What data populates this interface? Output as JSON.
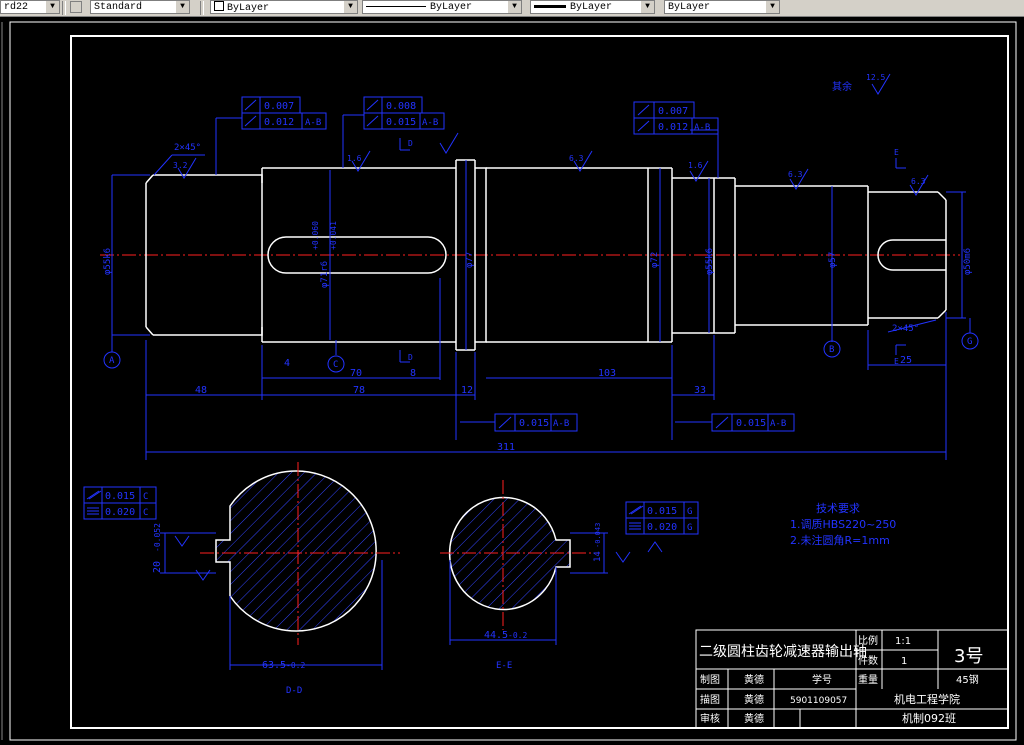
{
  "toolbar": {
    "dimstyle": "rd22",
    "textstyle": "Standard",
    "layer_color": "ByLayer",
    "linetype": "ByLayer",
    "lineweight": "ByLayer",
    "plotstyle": "ByLayer"
  },
  "drawing": {
    "roughness_default_label": "其余",
    "roughness_default_value": "12.5",
    "chamfer_left": "2×45°",
    "chamfer_right": "2×45°",
    "gdt_boxes": [
      {
        "row1": "0.007",
        "row2": "0.012",
        "datum": "A-B"
      },
      {
        "row1": "0.008",
        "row2": "0.015",
        "datum": "A-B"
      },
      {
        "row1": "0.007",
        "row2": "0.012",
        "datum": "A-B"
      }
    ],
    "gdt_bottom_left": {
      "value": "0.015",
      "datum": "A-B"
    },
    "gdt_bottom_right": {
      "value": "0.015",
      "datum": "A-B"
    },
    "roughness_marks": [
      "3.2",
      "1.6",
      "1.6",
      "6.3",
      "1.6",
      "6.3",
      "6.3",
      "3.2"
    ],
    "dims": {
      "d1": "φ55k6",
      "d2": "φ71r6",
      "d3": "φ77",
      "d4": "φ72",
      "d5": "φ55k6",
      "d6": "φ57",
      "d7": "φ50m6",
      "l_48": "48",
      "l_78": "78",
      "l_12": "12",
      "l_103": "103",
      "l_33": "33",
      "l_25": "25",
      "l_311": "311",
      "l_70": "70",
      "l_8": "8",
      "l_4": "4",
      "key_tol_top": "+0.060",
      "key_tol_bot": "+0.041"
    },
    "datums": [
      "A",
      "C",
      "B",
      "G"
    ],
    "section_marks": [
      "D",
      "D",
      "E",
      "E"
    ],
    "section_d": {
      "title": "D-D",
      "dim_width": "63.5",
      "dim_width_tol": "-0.2",
      "dim_key": "20",
      "dim_key_tol": "-0.052",
      "gdt1": {
        "value": "0.015",
        "datum": "C"
      },
      "gdt2": {
        "value": "0.020",
        "datum": "C"
      }
    },
    "section_e": {
      "title": "E-E",
      "dim_width": "44.5",
      "dim_width_tol": "-0.2",
      "dim_key": "14",
      "dim_key_tol": "-0.043",
      "gdt1": {
        "value": "0.015",
        "datum": "G"
      },
      "gdt2": {
        "value": "0.020",
        "datum": "G"
      }
    },
    "tech_req": {
      "title": "技术要求",
      "line1": "1.调质HBS220~250",
      "line2": "2.未注圆角R=1mm"
    }
  },
  "title_block": {
    "name": "二级圆柱齿轮减速器输出轴",
    "scale_label": "比例",
    "scale_value": "1:1",
    "qty_label": "件数",
    "qty_value": "1",
    "sheet": "3号",
    "weight_label": "重量",
    "material": "45钢",
    "r1c1": "制图",
    "r1c2": "黄德",
    "r1c3": "学号",
    "r2c1": "描图",
    "r2c2": "黄德",
    "r2c3": "5901109057",
    "r3c1": "审核",
    "r3c2": "黄德",
    "school": "机电工程学院",
    "class": "机制092班"
  },
  "colors": {
    "background": "#000000",
    "line_white": "#ffffff",
    "dim_blue": "#2233ff",
    "center_red": "#ff2020",
    "hatch_blue": "#3344ff"
  }
}
